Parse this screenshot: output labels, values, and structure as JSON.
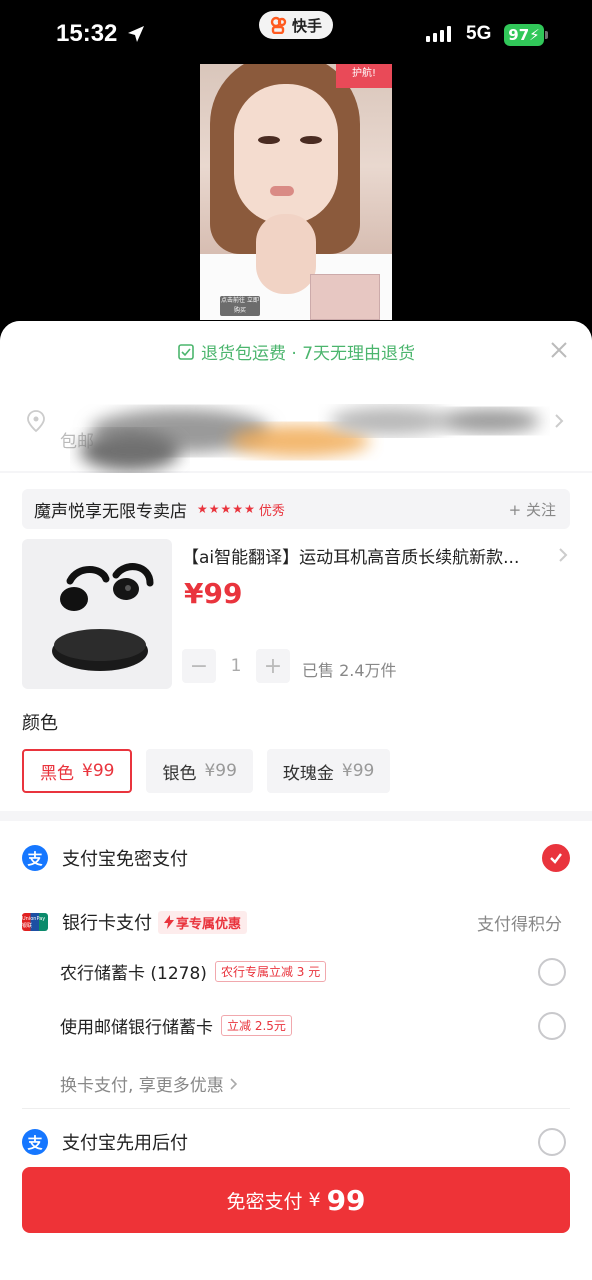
{
  "status_bar": {
    "time": "15:32",
    "app_name": "快手",
    "network": "5G",
    "battery": "97"
  },
  "video": {
    "label": "点击前往 立即购买",
    "tag": "护航!"
  },
  "sheet": {
    "guarantee_text": "退货包运费 · 7天无理由退货",
    "address_hint": "包邮"
  },
  "store": {
    "name": "魔声悦享无限专卖店",
    "grade": "优秀",
    "follow_label": "+ 关注"
  },
  "product": {
    "title": "【ai智能翻译】运动耳机高音质长续航新款...",
    "price": "¥99",
    "quantity": "1",
    "sold": "已售 2.4万件"
  },
  "color": {
    "label": "颜色",
    "options": [
      {
        "name": "黑色",
        "price": "¥99",
        "selected": true
      },
      {
        "name": "银色",
        "price": "¥99",
        "selected": false
      },
      {
        "name": "玫瑰金",
        "price": "¥99",
        "selected": false
      }
    ]
  },
  "payment": {
    "alipay_nopwd": "支付宝免密支付",
    "bank_card": "银行卡支付",
    "bank_promo": "享专属优惠",
    "points": "支付得积分",
    "card1": "农行储蓄卡 (1278)",
    "card1_tag": "农行专属立减 3 元",
    "card2": "使用邮储银行储蓄卡",
    "card2_tag": "立减 2.5元",
    "more": "换卡支付, 享更多优惠",
    "alipay_later": "支付宝先用后付",
    "alipay_icon_char": "支",
    "unionpay_icon_text": "UnionPay 银联"
  },
  "footer": {
    "button_label": "免密支付",
    "button_currency": "¥",
    "button_amount": "99"
  },
  "colors": {
    "accent": "#e9343d",
    "guarantee": "#4bb56d",
    "alipay": "#1677ff",
    "battery": "#31c759"
  }
}
